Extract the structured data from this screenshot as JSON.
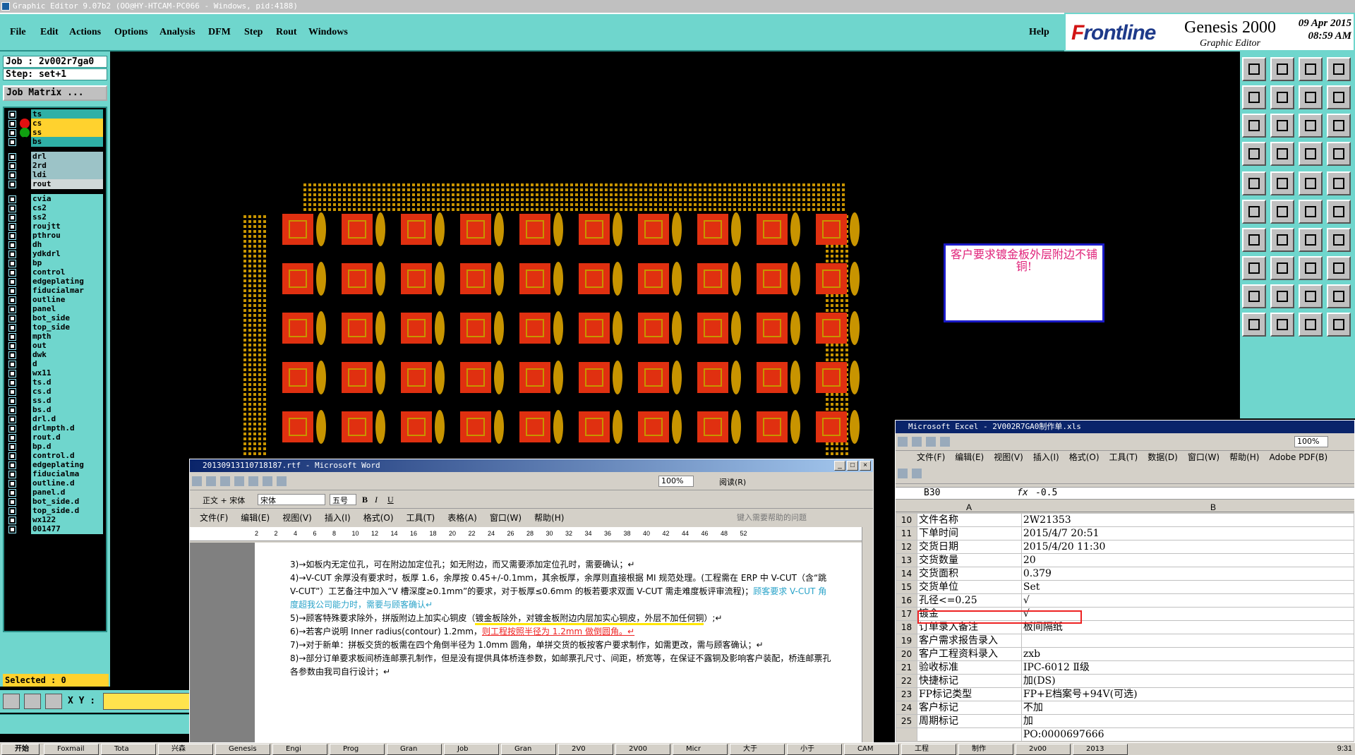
{
  "window": {
    "title": "Graphic Editor 9.07b2 (OO@HY-HTCAM-PC066 - Windows, pid:4188)"
  },
  "menu": {
    "items": [
      "File",
      "Edit",
      "Actions",
      "Options",
      "Analysis",
      "DFM",
      "Step",
      "Rout",
      "Windows"
    ],
    "help": "Help"
  },
  "brand": {
    "logo_prefix": "F",
    "logo_rest": "rontline",
    "product": "Genesis 2000",
    "subtitle": "Graphic Editor",
    "date": "09 Apr 2015",
    "time": "08:59 AM"
  },
  "job": {
    "job_label": "Job : 2v002r7ga0",
    "step_label": "Step: set+1",
    "matrix_button": "Job Matrix ..."
  },
  "layers": [
    {
      "name": "ts",
      "color": "#2fb0a6",
      "dot": "#000000"
    },
    {
      "name": "cs",
      "color": "#ffd22e",
      "dot": "#e01010"
    },
    {
      "name": "ss",
      "color": "#ffd22e",
      "dot": "#10a010"
    },
    {
      "name": "bs",
      "color": "#2fb0a6",
      "dot": "#000000"
    },
    {
      "name": "drl",
      "color": "#9cc3c7",
      "dot": "#000000"
    },
    {
      "name": "2rd",
      "color": "#9cc3c7",
      "dot": "#000000"
    },
    {
      "name": "ldi",
      "color": "#9cc3c7",
      "dot": "#000000"
    },
    {
      "name": "rout",
      "color": "#d0d8d8",
      "dot": "#000000"
    },
    {
      "name": "cvia",
      "color": "#6fd6cd",
      "dot": "#000000"
    },
    {
      "name": "cs2",
      "color": "#6fd6cd",
      "dot": "#000000"
    },
    {
      "name": "ss2",
      "color": "#6fd6cd",
      "dot": "#000000"
    },
    {
      "name": "roujtt",
      "color": "#6fd6cd",
      "dot": "#000000"
    },
    {
      "name": "pthrou",
      "color": "#6fd6cd",
      "dot": "#000000"
    },
    {
      "name": "dh",
      "color": "#6fd6cd",
      "dot": "#000000"
    },
    {
      "name": "ydkdrl",
      "color": "#6fd6cd",
      "dot": "#000000"
    },
    {
      "name": "bp",
      "color": "#6fd6cd",
      "dot": "#000000"
    },
    {
      "name": "control",
      "color": "#6fd6cd",
      "dot": "#000000"
    },
    {
      "name": "edgeplating",
      "color": "#6fd6cd",
      "dot": "#000000"
    },
    {
      "name": "fiducialmar",
      "color": "#6fd6cd",
      "dot": "#000000"
    },
    {
      "name": "outline",
      "color": "#6fd6cd",
      "dot": "#000000"
    },
    {
      "name": "panel",
      "color": "#6fd6cd",
      "dot": "#000000"
    },
    {
      "name": "bot_side",
      "color": "#6fd6cd",
      "dot": "#000000"
    },
    {
      "name": "top_side",
      "color": "#6fd6cd",
      "dot": "#000000"
    },
    {
      "name": "mpth",
      "color": "#6fd6cd",
      "dot": "#000000"
    },
    {
      "name": "out",
      "color": "#6fd6cd",
      "dot": "#000000"
    },
    {
      "name": "dwk",
      "color": "#6fd6cd",
      "dot": "#000000"
    },
    {
      "name": "d",
      "color": "#6fd6cd",
      "dot": "#000000"
    },
    {
      "name": "wx11",
      "color": "#6fd6cd",
      "dot": "#000000"
    },
    {
      "name": "ts.d",
      "color": "#6fd6cd",
      "dot": "#000000"
    },
    {
      "name": "cs.d",
      "color": "#6fd6cd",
      "dot": "#000000"
    },
    {
      "name": "ss.d",
      "color": "#6fd6cd",
      "dot": "#000000"
    },
    {
      "name": "bs.d",
      "color": "#6fd6cd",
      "dot": "#000000"
    },
    {
      "name": "drl.d",
      "color": "#6fd6cd",
      "dot": "#000000"
    },
    {
      "name": "drlmpth.d",
      "color": "#6fd6cd",
      "dot": "#000000"
    },
    {
      "name": "rout.d",
      "color": "#6fd6cd",
      "dot": "#000000"
    },
    {
      "name": "bp.d",
      "color": "#6fd6cd",
      "dot": "#000000"
    },
    {
      "name": "control.d",
      "color": "#6fd6cd",
      "dot": "#000000"
    },
    {
      "name": "edgeplating",
      "color": "#6fd6cd",
      "dot": "#000000"
    },
    {
      "name": "fiducialma",
      "color": "#6fd6cd",
      "dot": "#000000"
    },
    {
      "name": "outline.d",
      "color": "#6fd6cd",
      "dot": "#000000"
    },
    {
      "name": "panel.d",
      "color": "#6fd6cd",
      "dot": "#000000"
    },
    {
      "name": "bot_side.d",
      "color": "#6fd6cd",
      "dot": "#000000"
    },
    {
      "name": "top_side.d",
      "color": "#6fd6cd",
      "dot": "#000000"
    },
    {
      "name": "wx122",
      "color": "#6fd6cd",
      "dot": "#000000"
    },
    {
      "name": "001477",
      "color": "#6fd6cd",
      "dot": "#000000"
    }
  ],
  "status": {
    "selected": "Selected : 0",
    "xy_label": "X Y :"
  },
  "comment_box": {
    "text": "客户要求镀金板外层附边不铺铜!"
  },
  "word": {
    "title": "20130913110718187.rtf - Microsoft Word",
    "style": "正文 + 宋体",
    "font": "宋体",
    "size": "五号",
    "zoom": "100%",
    "read_button": "阅读(R)",
    "menu": [
      "文件(F)",
      "编辑(E)",
      "视图(V)",
      "插入(I)",
      "格式(O)",
      "工具(T)",
      "表格(A)",
      "窗口(W)",
      "帮助(H)"
    ],
    "help_placeholder": "键入需要帮助的问题",
    "ruler": [
      "2",
      "2",
      "4",
      "6",
      "8",
      "10",
      "12",
      "14",
      "16",
      "18",
      "20",
      "22",
      "24",
      "26",
      "28",
      "30",
      "32",
      "34",
      "36",
      "38",
      "40",
      "42",
      "44",
      "46",
      "48",
      "52"
    ],
    "para3": "3)→如板内无定位孔，可在附边加定位孔；如无附边，而又需要添加定位孔时，需要确认；↵",
    "para4a": "4)→V-CUT 余厚没有要求时，板厚 1.6，余厚按 0.45+/-0.1mm，其余板厚，余厚则直接根据 MI 规范处理。(工程需在 ERP 中 V-CUT（含“跳 V-CUT”）工艺备注中加入“V 槽深度≥0.1mm”的要求，对于板厚≤0.6mm 的板若要求双面 V-CUT 需走难度板评审流程)；",
    "para4b": "顾客要求 V-CUT 角度超我公司能力时，需要与顾客确认↵",
    "para5a": "5)→顾客特殊要求除外，拼版附边上加实心铜皮（",
    "para5b": "镀金板除外，对镀金板附边内层加实心铜皮，外层不加任何铜",
    "para5c": "）;↵",
    "para6a": "6)→若客户说明 Inner radius(contour) 1.2mm，",
    "para6b": "则工程按照半径为 1.2mm 做倒圆角。↵",
    "para7": "7)→对于新单：拼板交货的板需在四个角倒半径为 1.0mm 圆角，单拼交货的板按客户要求制作，如需更改，需与顾客确认；↵",
    "para8": "8)→部分订单要求板间桥连邮票孔制作，但是没有提供具体桥连参数，如邮票孔尺寸、间距，桥宽等，在保证不露铜及影响客户装配，桥连邮票孔各参数由我司自行设计；↵"
  },
  "excel": {
    "title": "Microsoft Excel - 2V002R7GA0制作单.xls",
    "menu": [
      "文件(F)",
      "编辑(E)",
      "视图(V)",
      "插入(I)",
      "格式(O)",
      "工具(T)",
      "数据(D)",
      "窗口(W)",
      "帮助(H)",
      "Adobe PDF(B)"
    ],
    "zoom": "100%",
    "name_box": "B30",
    "fx": "fx",
    "formula": "-0.5",
    "col_a": "A",
    "col_b": "B",
    "rows": [
      {
        "n": "10",
        "a": "文件名称",
        "b": "2W21353"
      },
      {
        "n": "11",
        "a": "下单时间",
        "b": "2015/4/7 20:51"
      },
      {
        "n": "12",
        "a": "交货日期",
        "b": "2015/4/20 11:30"
      },
      {
        "n": "13",
        "a": "交货数量",
        "b": "20"
      },
      {
        "n": "14",
        "a": "交货面积",
        "b": "0.379"
      },
      {
        "n": "15",
        "a": "交货单位",
        "b": "Set"
      },
      {
        "n": "16",
        "a": "孔径<=0.25",
        "b": "√"
      },
      {
        "n": "17",
        "a": "镀金",
        "b": "√"
      },
      {
        "n": "18",
        "a": "订单录入备注",
        "b": "板间隔纸"
      },
      {
        "n": "19",
        "a": "客户需求报告录入",
        "b": ""
      },
      {
        "n": "20",
        "a": "客户工程资料录入",
        "b": "zxb"
      },
      {
        "n": "21",
        "a": "验收标准",
        "b": "IPC-6012 Ⅱ级"
      },
      {
        "n": "22",
        "a": "快捷标记",
        "b": "加(DS)"
      },
      {
        "n": "23",
        "a": "FP标记类型",
        "b": "FP+E档案号+94V(可选)"
      },
      {
        "n": "24",
        "a": "客户标记",
        "b": "不加"
      },
      {
        "n": "25",
        "a": "周期标记",
        "b": "加"
      },
      {
        "n": "",
        "a": "",
        "b": "PO:0000697666"
      }
    ]
  },
  "taskbar": {
    "start": "开始",
    "items": [
      "Foxmail",
      "Tota",
      "兴森",
      "Genesis",
      "Engi",
      "Prog",
      "Gran",
      "Job",
      "Gran",
      "2V0",
      "2V00",
      "Micr",
      "大于",
      "小于",
      "CAM",
      "工程",
      "制作",
      "2v00",
      "2013"
    ],
    "clock": "9:31"
  }
}
